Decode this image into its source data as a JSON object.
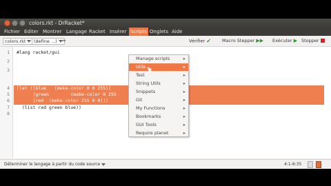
{
  "window": {
    "title": "colors.rkt - DrRacket*"
  },
  "menu": {
    "items": [
      "Fichier",
      "Editer",
      "Montrer",
      "Langage",
      "Racket",
      "Insérer",
      "Scripts",
      "Onglets",
      "Aide"
    ],
    "active": "Scripts"
  },
  "toolbar": {
    "file_label": "colors.rkt",
    "define_label": "(define ...)",
    "verify_label": "Vérifier",
    "macro_label": "Macro Stepper",
    "run_label": "Exécuter",
    "stop_label": "Stopper"
  },
  "editor": {
    "line_numbers": [
      "1",
      "2",
      "3",
      "4",
      "5",
      "6",
      "7",
      "8"
    ],
    "lines": [
      "#lang racket/gui",
      "",
      "",
      "(let ([blue   (make-color 0 0 255)]",
      "      [green        (make-color 0 255",
      "      [red  (make-color 255 0 0)])",
      "  (list red green blue))",
      ""
    ]
  },
  "scripts_menu": {
    "items": [
      {
        "label": "Manage scripts",
        "submenu": true
      },
      {
        "label": "Utils",
        "submenu": true
      },
      {
        "label": "Test",
        "submenu": true
      },
      {
        "label": "String Utils",
        "submenu": true
      },
      {
        "label": "Snippets",
        "submenu": true
      },
      {
        "label": "Git",
        "submenu": true
      },
      {
        "label": "My Functions",
        "submenu": true
      },
      {
        "label": "Bookmarks",
        "submenu": true
      },
      {
        "label": "GUI Tools",
        "submenu": true
      },
      {
        "label": "Require planet",
        "submenu": true
      }
    ],
    "highlighted_index": 1
  },
  "status": {
    "left": "Déterminer le langage à partir du code source",
    "right": "4:1-6:35"
  },
  "colors": {
    "accent": "#f07746",
    "selection": "#f07f4f"
  }
}
